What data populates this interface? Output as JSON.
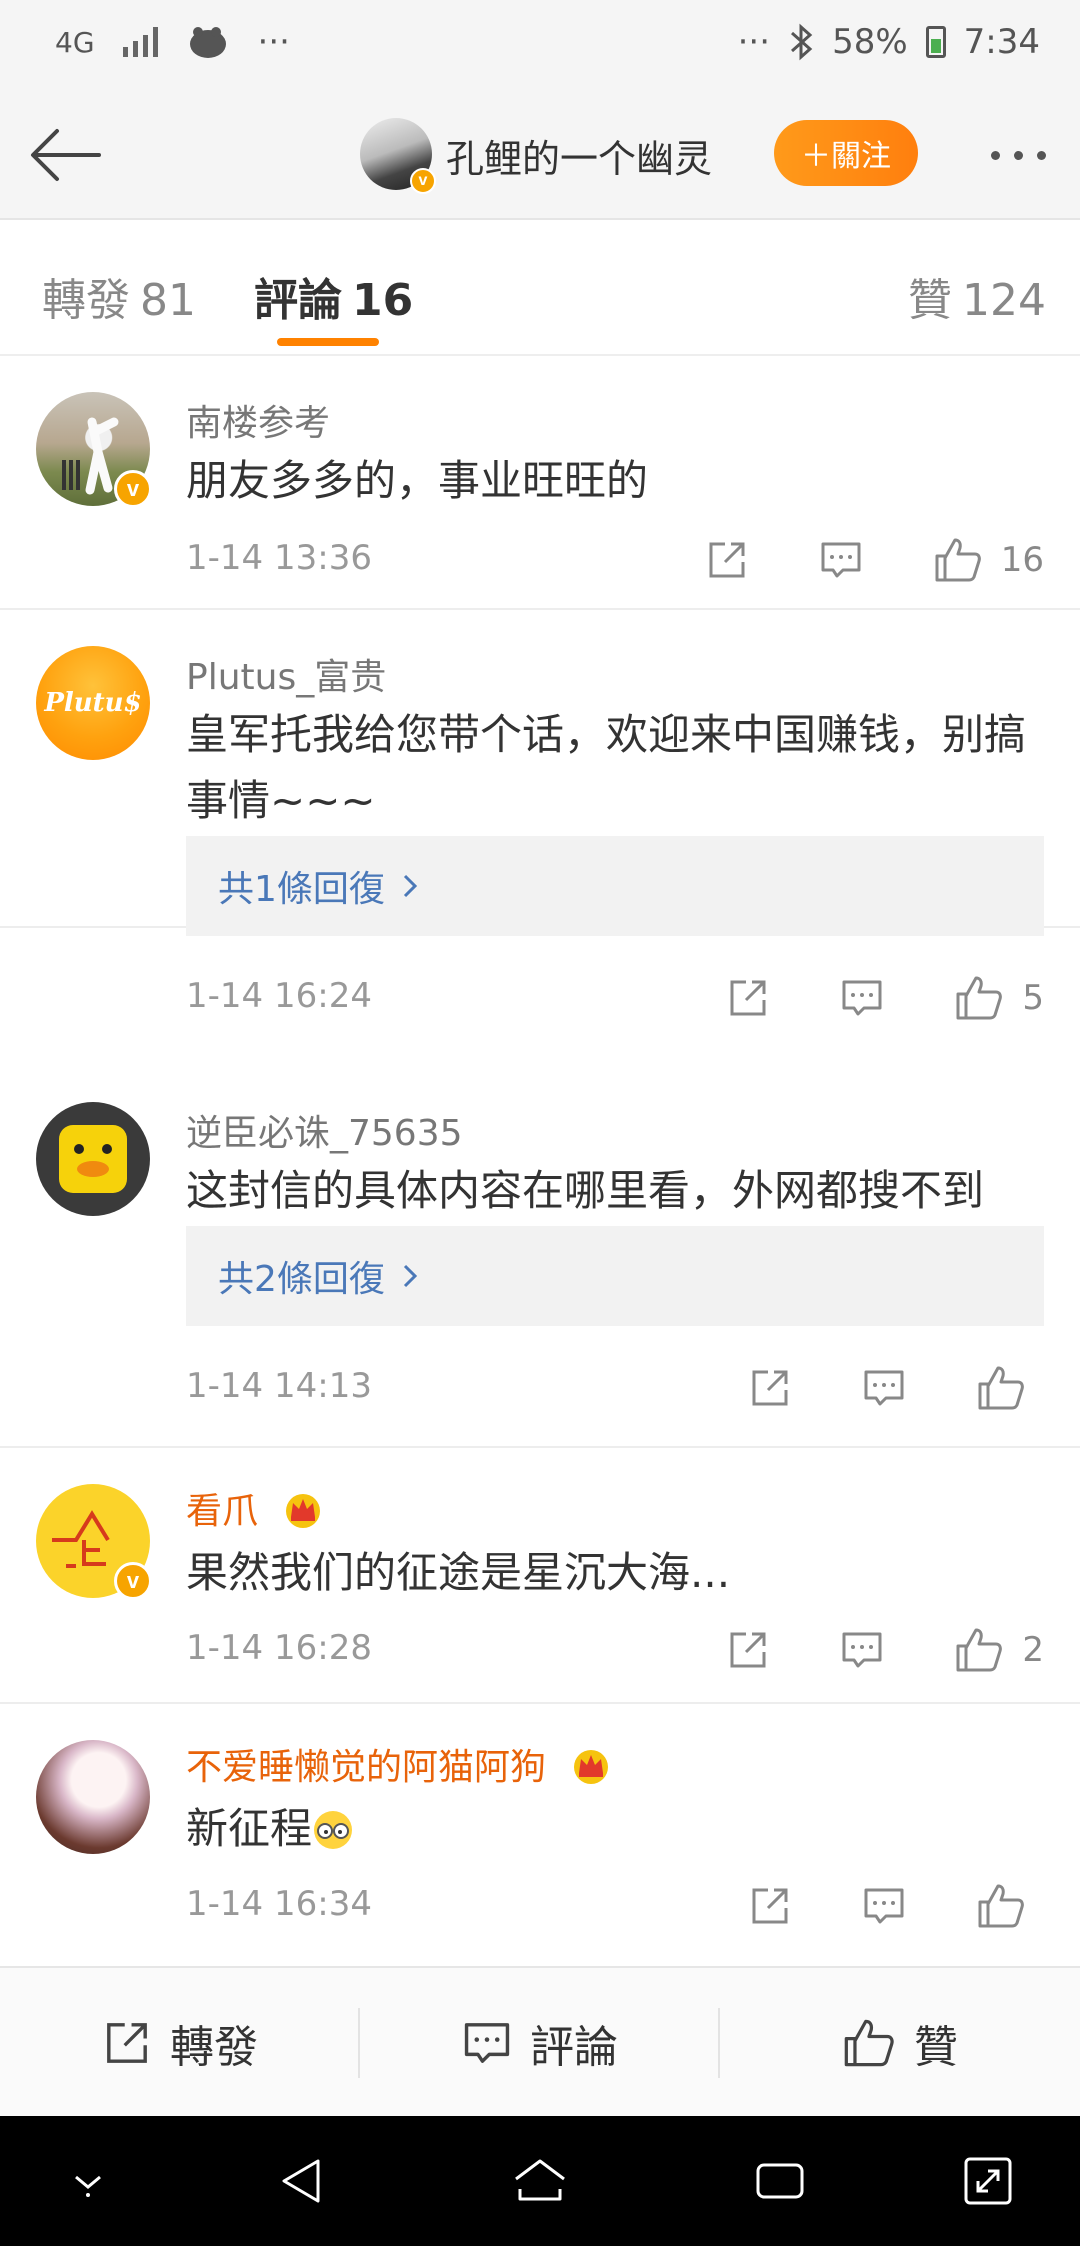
{
  "status_bar": {
    "network": "4G",
    "left_ellipsis": "···",
    "right_ellipsis": "···",
    "battery": "58%",
    "time": "7:34"
  },
  "nav": {
    "title": "孔鲤的一个幽灵",
    "follow_label": "＋關注"
  },
  "tabs": [
    {
      "label": "轉發",
      "count": "81"
    },
    {
      "label": "評論",
      "count": "16"
    },
    {
      "label": "贊",
      "count": "124"
    }
  ],
  "comments": [
    {
      "user": "南楼参考",
      "text": "朋友多多的，事业旺旺的",
      "time": "1-14 13:36",
      "likes": "16"
    },
    {
      "user": "Plutus_富贵",
      "avatar_text": "Plutu$",
      "text": "皇军托我给您带个话，欢迎来中国赚钱，别搞事情~~~",
      "reply": "共1條回復",
      "time": "1-14 16:24",
      "likes": "5"
    },
    {
      "user": "逆臣必诛_75635",
      "text": "这封信的具体内容在哪里看，外网都搜不到",
      "reply": "共2條回復",
      "time": "1-14 14:13",
      "likes": ""
    },
    {
      "user": "看爪",
      "text": "果然我们的征途是星沉大海...",
      "time": "1-14 16:28",
      "likes": "2"
    },
    {
      "user": "不爱睡懒觉的阿猫阿狗",
      "text": "新征程",
      "time": "1-14 16:34",
      "likes": ""
    }
  ],
  "bottom_bar": {
    "repost": "轉發",
    "comment": "評論",
    "like": "贊"
  },
  "colors": {
    "accent": "#ff8200",
    "link": "#4a78b8",
    "vip_name": "#e8630a"
  },
  "icons": [
    "back-arrow-icon",
    "share-icon",
    "comment-icon",
    "thumbs-up-icon",
    "chevron-right-icon",
    "crown-icon",
    "verified-icon"
  ]
}
